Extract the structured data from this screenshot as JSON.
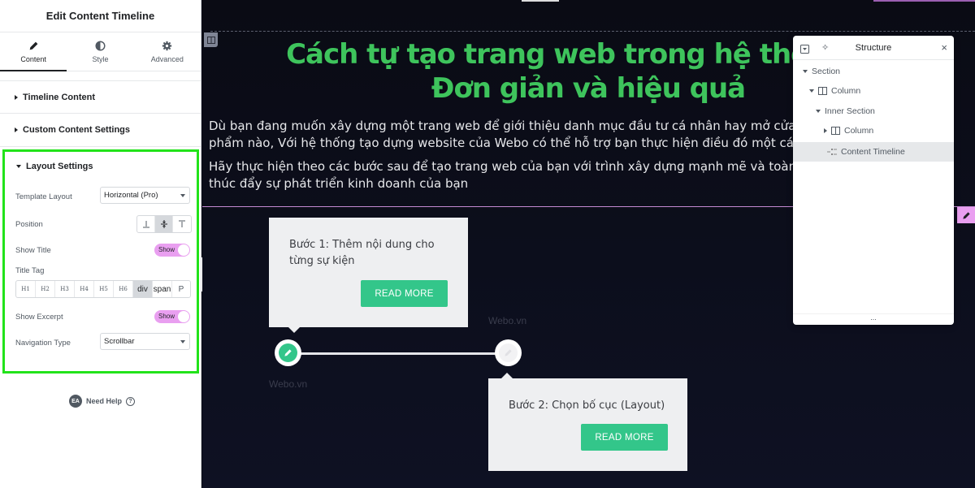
{
  "panel": {
    "title": "Edit Content Timeline",
    "tabs": [
      {
        "label": "Content",
        "icon": "pencil-icon",
        "active": true
      },
      {
        "label": "Style",
        "icon": "half-circle-icon",
        "active": false
      },
      {
        "label": "Advanced",
        "icon": "gear-icon",
        "active": false
      }
    ],
    "sections": [
      {
        "label": "Timeline Content",
        "expanded": false
      },
      {
        "label": "Custom Content Settings",
        "expanded": false
      }
    ],
    "layout": {
      "title": "Layout Settings",
      "template_layout": {
        "label": "Template Layout",
        "value": "Horizontal (Pro)"
      },
      "position": {
        "label": "Position",
        "options": [
          "bottom",
          "middle",
          "top"
        ],
        "selected": "middle"
      },
      "show_title": {
        "label": "Show Title",
        "toggle": "Show"
      },
      "title_tag": {
        "label": "Title Tag",
        "options": [
          "H1",
          "H2",
          "H3",
          "H4",
          "H5",
          "H6",
          "div",
          "span",
          "P"
        ],
        "selected": "div"
      },
      "show_excerpt": {
        "label": "Show Excerpt",
        "toggle": "Show"
      },
      "navigation_type": {
        "label": "Navigation Type",
        "value": "Scrollbar"
      }
    },
    "help": {
      "badge": "EA",
      "label": "Need Help"
    }
  },
  "canvas": {
    "heading_line1": "Cách tự tạo trang web trong hệ thống Lo",
    "heading_line2": "Đơn giản và hiệu quả",
    "para1_line1": "Dù bạn đang muốn xây dựng một trang web để giới thiệu danh mục đầu tư cá nhân hay mở cửa hàng tr",
    "para1_line2": "phẩm nào, Với hệ thống tạo dựng website của Webo có thể hỗ trợ bạn thực hiện điều đó một cách dễ d",
    "para2_line1": "Hãy thực hiện theo các bước sau để tạo trang web của bạn với trình xây dựng mạnh mẽ và toàn diện c",
    "para2_line1_tail": "n",
    "para2_line2": "thúc đẩy sự phát triển kinh doanh của bạn",
    "timeline": [
      {
        "text": "Bước 1: Thêm nội dung cho từng sự kiện",
        "button": "READ MORE",
        "watermark": "Webo.vn"
      },
      {
        "text": "Bước 2: Chọn bố cục (Layout)",
        "button": "READ MORE",
        "watermark": "Webo.vn"
      }
    ],
    "colors": {
      "heading": "#3ec45c",
      "button": "#33c68a",
      "accent": "#e99ff0",
      "highlight": "#22e31a"
    }
  },
  "structure": {
    "title": "Structure",
    "items": [
      {
        "label": "Section"
      },
      {
        "label": "Column"
      },
      {
        "label": "Inner Section"
      },
      {
        "label": "Column"
      },
      {
        "label": "Content Timeline",
        "active": true
      }
    ],
    "footer": "..."
  }
}
